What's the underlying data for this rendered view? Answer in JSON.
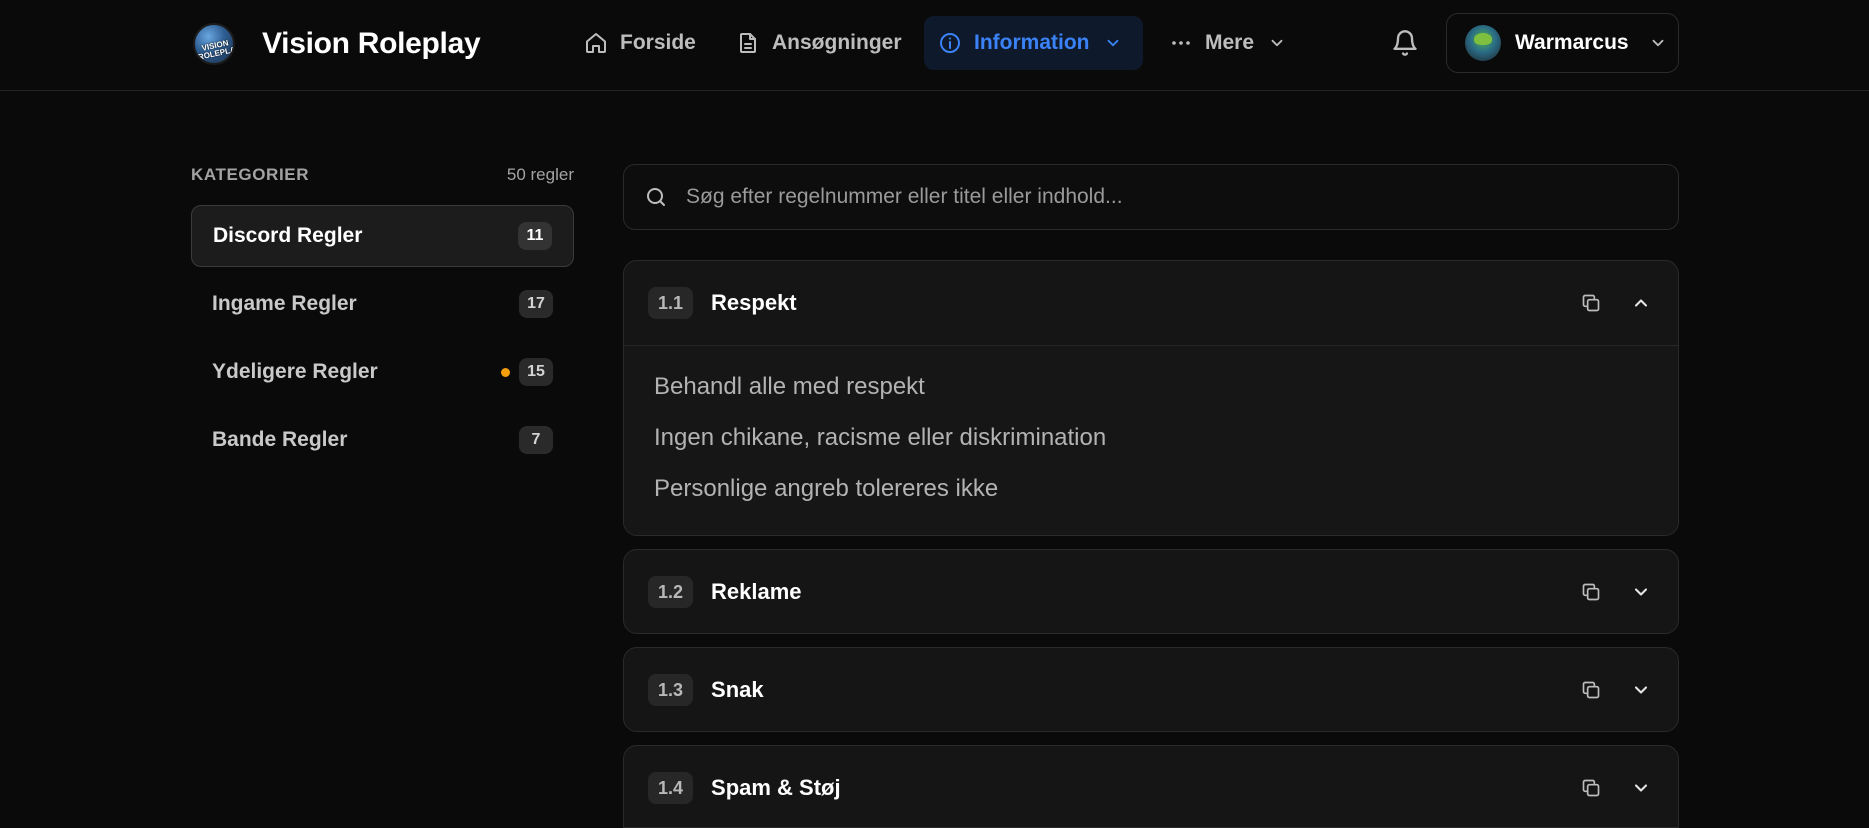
{
  "header": {
    "brand": "Vision Roleplay",
    "logo_text": "VISION ROLEPLAY",
    "nav": [
      {
        "label": "Forside",
        "icon": "home-icon"
      },
      {
        "label": "Ansøgninger",
        "icon": "document-icon"
      },
      {
        "label": "Information",
        "icon": "info-icon",
        "active": true
      },
      {
        "label": "Mere",
        "icon": "more-icon"
      }
    ],
    "user": {
      "name": "Warmarcus"
    }
  },
  "sidebar": {
    "heading": "KATEGORIER",
    "total": "50 regler",
    "items": [
      {
        "label": "Discord Regler",
        "count": "11",
        "active": true
      },
      {
        "label": "Ingame Regler",
        "count": "17"
      },
      {
        "label": "Ydeligere Regler",
        "count": "15",
        "dot": true
      },
      {
        "label": "Bande Regler",
        "count": "7"
      }
    ]
  },
  "search": {
    "placeholder": "Søg efter regelnummer eller titel eller indhold..."
  },
  "rules": [
    {
      "num": "1.1",
      "title": "Respekt",
      "expanded": true,
      "lines": [
        "Behandl alle med respekt",
        "Ingen chikane, racisme eller diskrimination",
        "Personlige angreb tolereres ikke"
      ]
    },
    {
      "num": "1.2",
      "title": "Reklame"
    },
    {
      "num": "1.3",
      "title": "Snak"
    },
    {
      "num": "1.4",
      "title": "Spam & Støj"
    }
  ],
  "colors": {
    "accent": "#3b82f6",
    "background": "#0a0a0a",
    "card": "#151515",
    "dot": "#f59e0b"
  }
}
